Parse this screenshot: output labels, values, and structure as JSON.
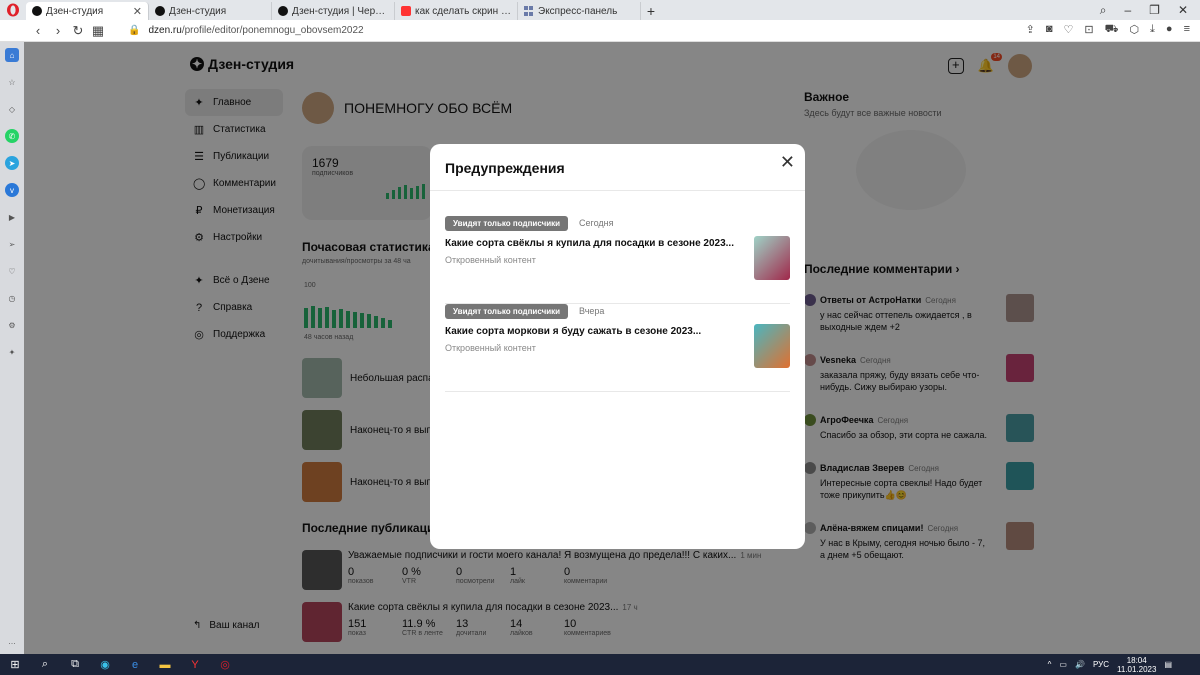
{
  "browser": {
    "tabs": [
      {
        "label": "Дзен-студия",
        "icon": "dzen",
        "active": true
      },
      {
        "label": "Дзен-студия",
        "icon": "dzen",
        "active": false
      },
      {
        "label": "Дзен-студия | Черновик |",
        "icon": "dzen",
        "active": false
      },
      {
        "label": "как сделать скрин экрана",
        "icon": "yandex",
        "active": false
      },
      {
        "label": "Экспресс-панель",
        "icon": "grid",
        "active": false
      }
    ],
    "url_domain": "dzen.ru",
    "url_path": "/profile/editor/ponemnogu_obovsem2022"
  },
  "studio": {
    "logo": "Дзен-студия",
    "notification_count": "14",
    "menu": [
      {
        "label": "Главное",
        "icon": "dzen-icon",
        "active": true
      },
      {
        "label": "Статистика",
        "icon": "stats-icon"
      },
      {
        "label": "Публикации",
        "icon": "publications-icon"
      },
      {
        "label": "Комментарии",
        "icon": "comments-icon"
      },
      {
        "label": "Монетизация",
        "icon": "ruble-icon"
      },
      {
        "label": "Настройки",
        "icon": "gear-icon"
      }
    ],
    "menu2": [
      {
        "label": "Всё о Дзене",
        "icon": "dzen-icon"
      },
      {
        "label": "Справка",
        "icon": "help-icon"
      },
      {
        "label": "Поддержка",
        "icon": "support-icon"
      }
    ],
    "your_channel": "Ваш канал",
    "channel_name": "ПОНЕМНОГУ ОБО ВСЁМ",
    "subscribers_count": "1679",
    "subscribers_label": "подписчиков",
    "hourly_title": "Почасовая статистика",
    "hourly_sub": "дочитывания/просмотры за 48 ча",
    "hourly_axis_max": "100",
    "hourly_axis_label": "48 часов назад",
    "posts": [
      {
        "title": "Небольшая распак"
      },
      {
        "title": "Наконец-то я выпи"
      },
      {
        "title": "Наконец-то я выпи"
      }
    ],
    "last_pubs_title": "Последние публикации",
    "last_pubs": [
      {
        "title": "Уважаемые подписчики и гости моего канала! Я возмущена до предела!!! С каких...",
        "time": "1 мин",
        "stats": [
          {
            "v": "0",
            "l": "показов"
          },
          {
            "v": "0 %",
            "l": "VTR"
          },
          {
            "v": "0",
            "l": "посмотрели"
          },
          {
            "v": "1",
            "l": "лайк"
          },
          {
            "v": "0",
            "l": "комментарии"
          }
        ]
      },
      {
        "title": "Какие сорта свёклы я купила для посадки в сезоне 2023...",
        "time": "17 ч",
        "stats": [
          {
            "v": "151",
            "l": "показ"
          },
          {
            "v": "11.9 %",
            "l": "CTR в ленте"
          },
          {
            "v": "13",
            "l": "дочитали"
          },
          {
            "v": "14",
            "l": "лайков"
          },
          {
            "v": "10",
            "l": "комментариев"
          }
        ]
      }
    ],
    "important_title": "Важное",
    "important_sub": "Здесь будут все важные новости",
    "last_comments_title": "Последние комментарии",
    "comments": [
      {
        "author": "Ответы от АстроНатки",
        "time": "Сегодня",
        "text": "у нас сейчас оттепель ожидается , в выходные ждем +2"
      },
      {
        "author": "Vesneka",
        "time": "Сегодня",
        "text": "заказала пряжу, буду вязать себе что-нибудь. Сижу выбираю узоры."
      },
      {
        "author": "АгроФеечка",
        "time": "Сегодня",
        "text": "Спасибо за обзор, эти сорта не сажала."
      },
      {
        "author": "Владислав Зверев",
        "time": "Сегодня",
        "text": "Интересные сорта свеклы! Надо будет тоже прикупить👍😊"
      },
      {
        "author": "Алёна-вяжем спицами!",
        "time": "Сегодня",
        "text": "У нас в Крыму, сегодня ночью было - 7, а днем +5 обещают."
      }
    ]
  },
  "modal": {
    "title": "Предупреждения",
    "items": [
      {
        "tag": "Увидят только подписчики",
        "when": "Сегодня",
        "title": "Какие сорта свёклы я купила для посадки в сезоне 2023...",
        "sub": "Откровенный контент"
      },
      {
        "tag": "Увидят только подписчики",
        "when": "Вчера",
        "title": "Какие сорта моркови я буду сажать в сезоне 2023...",
        "sub": "Откровенный контент"
      }
    ]
  },
  "taskbar": {
    "lang": "РУС",
    "time": "18:04",
    "date": "11.01.2023"
  }
}
